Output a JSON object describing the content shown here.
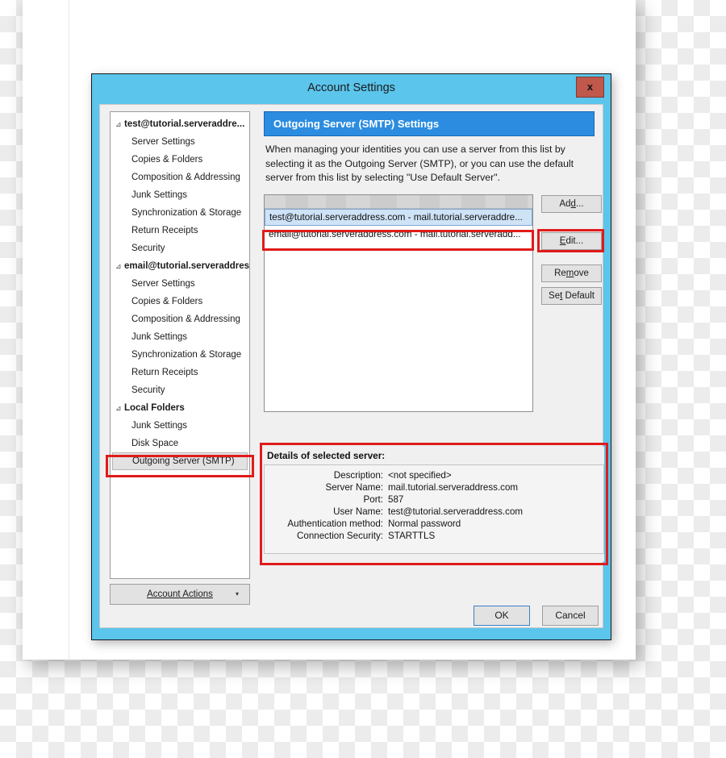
{
  "window": {
    "title": "Account Settings",
    "close_label": "x",
    "accent_titlebar": "#5bc5ec",
    "close_button_color": "#c0584c",
    "highlight_color": "#e01b1b"
  },
  "sidebar": {
    "items": [
      {
        "label": "test@tutorial.serveraddre...",
        "type": "account"
      },
      {
        "label": "Server Settings",
        "type": "child"
      },
      {
        "label": "Copies & Folders",
        "type": "child"
      },
      {
        "label": "Composition & Addressing",
        "type": "child"
      },
      {
        "label": "Junk Settings",
        "type": "child"
      },
      {
        "label": "Synchronization & Storage",
        "type": "child"
      },
      {
        "label": "Return Receipts",
        "type": "child"
      },
      {
        "label": "Security",
        "type": "child"
      },
      {
        "label": "email@tutorial.serveraddres...",
        "type": "account"
      },
      {
        "label": "Server Settings",
        "type": "child"
      },
      {
        "label": "Copies & Folders",
        "type": "child"
      },
      {
        "label": "Composition & Addressing",
        "type": "child"
      },
      {
        "label": "Junk Settings",
        "type": "child"
      },
      {
        "label": "Synchronization & Storage",
        "type": "child"
      },
      {
        "label": "Return Receipts",
        "type": "child"
      },
      {
        "label": "Security",
        "type": "child"
      },
      {
        "label": "Local Folders",
        "type": "account"
      },
      {
        "label": "Junk Settings",
        "type": "child"
      },
      {
        "label": "Disk Space",
        "type": "child"
      },
      {
        "label": "Outgoing Server (SMTP)",
        "type": "child",
        "selected": true
      }
    ],
    "twisty_glyph": "⊿",
    "account_actions": {
      "label": "Account Actions",
      "accelerator": "A",
      "caret": "▾"
    }
  },
  "pane": {
    "header": "Outgoing Server (SMTP) Settings",
    "description": "When managing your identities you can use a server from this list by selecting it as the Outgoing Server (SMTP), or you can use the default server from this list by selecting \"Use Default Server\"."
  },
  "server_list": {
    "rows": [
      {
        "label": "test@tutorial.serveraddress.com - mail.tutorial.serveraddre...",
        "selected": true
      },
      {
        "label": "email@tutorial.serveraddress.com - mail.tutorial.serveradd...",
        "selected": false
      }
    ]
  },
  "side_buttons": [
    {
      "name": "add",
      "label": "Add...",
      "accel_index": 2
    },
    {
      "name": "edit",
      "label": "Edit...",
      "accel_index": 0
    },
    {
      "name": "remove",
      "label": "Remove",
      "accel_index": 2
    },
    {
      "name": "set-default",
      "label": "Set Default",
      "accel_index": 2
    }
  ],
  "details": {
    "title": "Details of selected server:",
    "rows": [
      {
        "key": "Description:",
        "value": "<not specified>"
      },
      {
        "key": "Server Name:",
        "value": "mail.tutorial.serveraddress.com"
      },
      {
        "key": "Port:",
        "value": "587"
      },
      {
        "key": "User Name:",
        "value": "test@tutorial.serveraddress.com"
      },
      {
        "key": "Authentication method:",
        "value": "Normal password"
      },
      {
        "key": "Connection Security:",
        "value": "STARTTLS"
      }
    ]
  },
  "footer": {
    "ok": "OK",
    "cancel": "Cancel"
  }
}
